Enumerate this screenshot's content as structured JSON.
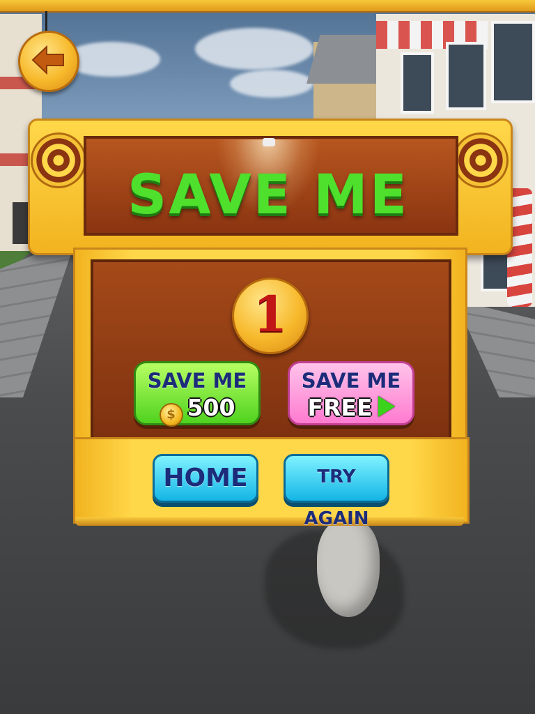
{
  "title": "SAVE ME",
  "counter": "1",
  "save_coins": {
    "line1": "SAVE ME",
    "amount": "500",
    "coin_icon": "coin-icon"
  },
  "save_free": {
    "line1": "SAVE ME",
    "line2": "FREE",
    "icon": "play-icon"
  },
  "buttons": {
    "home": "HOME",
    "try_again": "TRY AGAIN"
  },
  "back_icon": "back-arrow-icon",
  "colors": {
    "title_green": "#4ee02c",
    "panel_gold": "#ffd84a",
    "board_brown": "#8a3411",
    "button_blue": "#14b5e6",
    "button_green": "#4fd21f",
    "button_pink": "#ff7bd0",
    "counter_red": "#c21515"
  }
}
